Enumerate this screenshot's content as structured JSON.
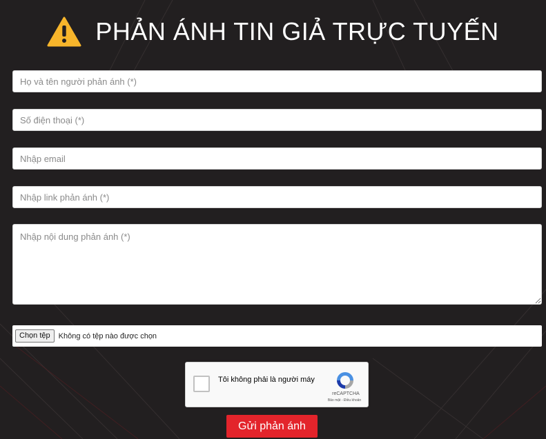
{
  "header": {
    "title": "PHẢN ÁNH TIN GIẢ TRỰC TUYẾN",
    "icon": "warning-triangle-icon"
  },
  "form": {
    "name_placeholder": "Họ và tên người phản ánh (*)",
    "phone_placeholder": "Số điện thoại (*)",
    "email_placeholder": "Nhập email",
    "link_placeholder": "Nhập link phản ánh (*)",
    "content_placeholder": "Nhập nội dung phản ánh (*)",
    "file_button_label": "Chọn tệp",
    "file_status": "Không có tệp nào được chọn"
  },
  "recaptcha": {
    "label": "Tôi không phải là người máy",
    "brand": "reCAPTCHA",
    "links": "Bảo mật - Điều khoản"
  },
  "submit_label": "Gửi phản ánh",
  "colors": {
    "background": "#221f20",
    "warning_yellow": "#f7b52b",
    "submit_red": "#e3242b",
    "title_text": "#ffffff"
  }
}
